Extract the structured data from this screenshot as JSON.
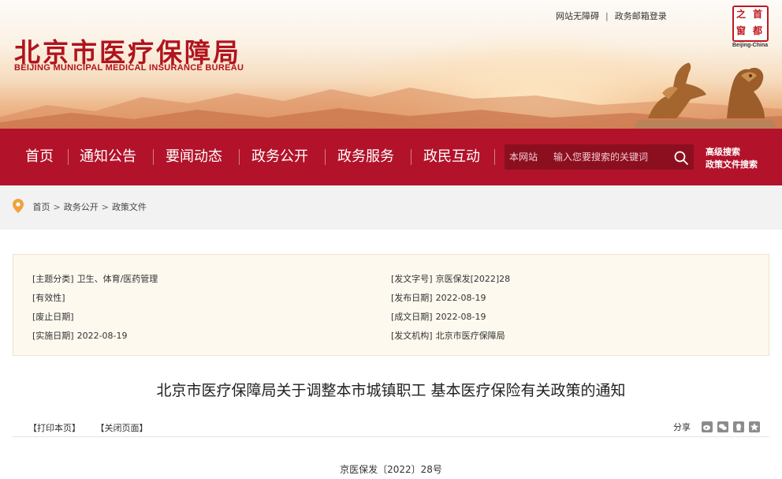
{
  "header": {
    "logo_cn": "北京市医疗保障局",
    "logo_en": "BEIJING MUNICIPAL MEDICAL INSURANCE BUREAU",
    "top_links": [
      "网站无障碍",
      "政务邮箱登录"
    ],
    "top_links_sep": "|",
    "seal_chars": [
      "之",
      "首",
      "都",
      "窗"
    ],
    "seal_en": "Beijing-China"
  },
  "nav": {
    "items": [
      "首页",
      "通知公告",
      "要闻动态",
      "政务公开",
      "政务服务",
      "政民互动"
    ],
    "search_scope": "本网站",
    "search_placeholder": "​输入您要搜索的关键词",
    "advanced_search": "高级搜索",
    "policy_search": "政策文件搜索"
  },
  "breadcrumb": {
    "items": [
      "首页",
      "政务公开",
      "政策文件"
    ],
    "separator": ">"
  },
  "meta": {
    "left": [
      {
        "key": "[主题分类]",
        "value": "卫生、体育/医药管理"
      },
      {
        "key": "[有效性]",
        "value": ""
      },
      {
        "key": "[废止日期]",
        "value": ""
      },
      {
        "key": "[实施日期]",
        "value": "2022-08-19"
      }
    ],
    "right": [
      {
        "key": "[发文字号]",
        "value": "京医保发[2022]28"
      },
      {
        "key": "[发布日期]",
        "value": "2022-08-19"
      },
      {
        "key": "[成文日期]",
        "value": "2022-08-19"
      },
      {
        "key": "[发文机构]",
        "value": "北京市医疗保障局"
      }
    ]
  },
  "document": {
    "title": "北京市医疗保障局关于调整本市城镇职工 基本医疗保险有关政策的通知",
    "print_label": "【打印本页】",
    "close_label": "【关闭页面】",
    "share_label": "分享",
    "share_icons": [
      "weibo-icon",
      "wechat-icon",
      "qq-icon",
      "qzone-icon"
    ],
    "doc_number": "京医保发〔2022〕28号"
  },
  "colors": {
    "brand_red": "#b2132a",
    "search_bg": "#8c0f20",
    "meta_bg": "#fdf9ef",
    "pin_orange": "#f0a23c"
  }
}
